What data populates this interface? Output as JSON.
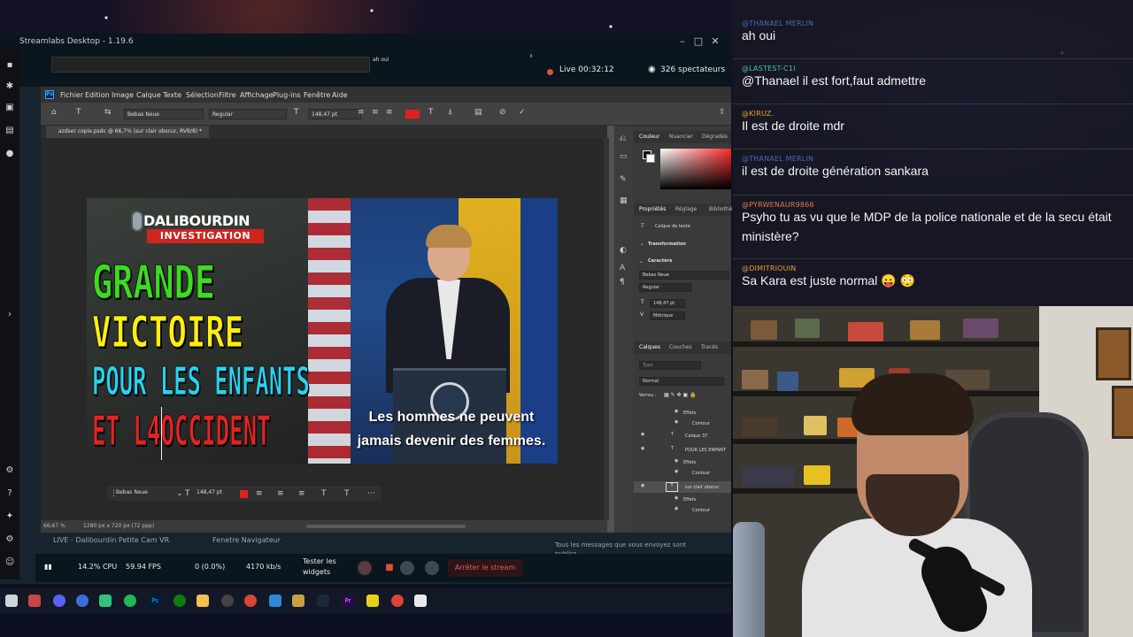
{
  "app": {
    "title": "Streamlabs Desktop - 1.19.6",
    "live_status": "Live 00:32:12",
    "viewers": "326 spectateurs",
    "preview_label": "ah oui"
  },
  "photoshop": {
    "logo": "Ps",
    "menu": [
      "Fichier",
      "Edition",
      "Image",
      "Calque",
      "Texte",
      "Sélection",
      "Filtre",
      "Affichage",
      "Plug-ins",
      "Fenêtre",
      "Aide"
    ],
    "options": {
      "font_family": "Bebas Neue",
      "font_style": "Regular",
      "font_size": "148,47 pt"
    },
    "document_tab": "azdser copie.psdc @ 66,7% (sur clair obscur, RVB/8) *",
    "status": {
      "zoom": "66,67 %",
      "dimensions": "1280 px x 720 px (72 ppp)"
    },
    "panels": {
      "color_tabs": [
        "Couleur",
        "Nuancier",
        "Dégradés"
      ],
      "props_tabs": [
        "Propriétés",
        "Réglage",
        "Bibliothè"
      ],
      "props_layer_type": "Calque de texte",
      "section_transform": "Transformation",
      "section_character": "Caractère",
      "char_font": "Bebas Neue",
      "char_style": "Regular",
      "char_size": "148,47 pt",
      "char_kerning": "Métrique",
      "layers_tabs": [
        "Calques",
        "Couches",
        "Tracés"
      ],
      "layer_search": "Type",
      "blend_mode": "Normal",
      "lock_label": "Verrou :",
      "layers": [
        {
          "name": "Effets",
          "kind": "effect"
        },
        {
          "name": "Contour",
          "kind": "effect"
        },
        {
          "name": "Calque 37",
          "kind": "text"
        },
        {
          "name": "POUR LES ENFANT",
          "kind": "text"
        },
        {
          "name": "Effets",
          "kind": "effect"
        },
        {
          "name": "Contour",
          "kind": "effect"
        },
        {
          "name": "sur clair obscur",
          "kind": "text"
        },
        {
          "name": "Effets",
          "kind": "effect"
        },
        {
          "name": "Contour",
          "kind": "effect"
        }
      ]
    },
    "context_bar": {
      "font": "Bebas Neue",
      "size": "148,47 pt",
      "more": "···"
    }
  },
  "thumbnail": {
    "logo_top": "DALIBOURDIN",
    "logo_bottom": "INVESTIGATION",
    "line1": "GRANDE",
    "line2": "VICTOIRE",
    "line3": "POUR LES ENFANTS",
    "line4": "ET L4OCCIDENT",
    "subtitle": "Les hommes ne peuvent jamais devenir des femmes."
  },
  "streamlabs": {
    "sources": [
      "LIVE - Dalibourdin Petite Cam VR",
      "Fenetre Navigateur"
    ],
    "chat_hint": "Tous les messages que vous envoyez sont publics",
    "stats": {
      "cpu": "14.2% CPU",
      "fps": "59.94 FPS",
      "dropped": "0 (0.0%)",
      "bitrate": "4170 kb/s"
    },
    "test_widgets": "Tester les widgets",
    "stop_stream": "Arrêter le stream"
  },
  "chat": {
    "messages": [
      {
        "user": "@THANAEL MERLIN",
        "text": "ah oui"
      },
      {
        "user": "@LASTEST-C1I",
        "text": "@Thanael il est fort,faut admettre"
      },
      {
        "user": "@KIRUZ.",
        "text": "Il est de droite mdr"
      },
      {
        "user": "@THANAEL MERLIN",
        "text": "il est de droite génération sankara"
      },
      {
        "user": "@PYRWENAUR9866",
        "text": "Psyho tu as vu que le MDP de la police nationale et de la secu était ministère?"
      },
      {
        "user": "@DIMITRIOUIN",
        "text": "Sa Kara est juste normal 😛 😳"
      }
    ]
  },
  "colors": {
    "accent_live": "#e74c3c",
    "chat_user": "#e07a4a",
    "headline_green": "#3cdc20",
    "headline_yellow": "#ffee10",
    "headline_cyan": "#2ad2f0",
    "headline_red": "#e52422",
    "ps_blue": "#31a8ff"
  }
}
